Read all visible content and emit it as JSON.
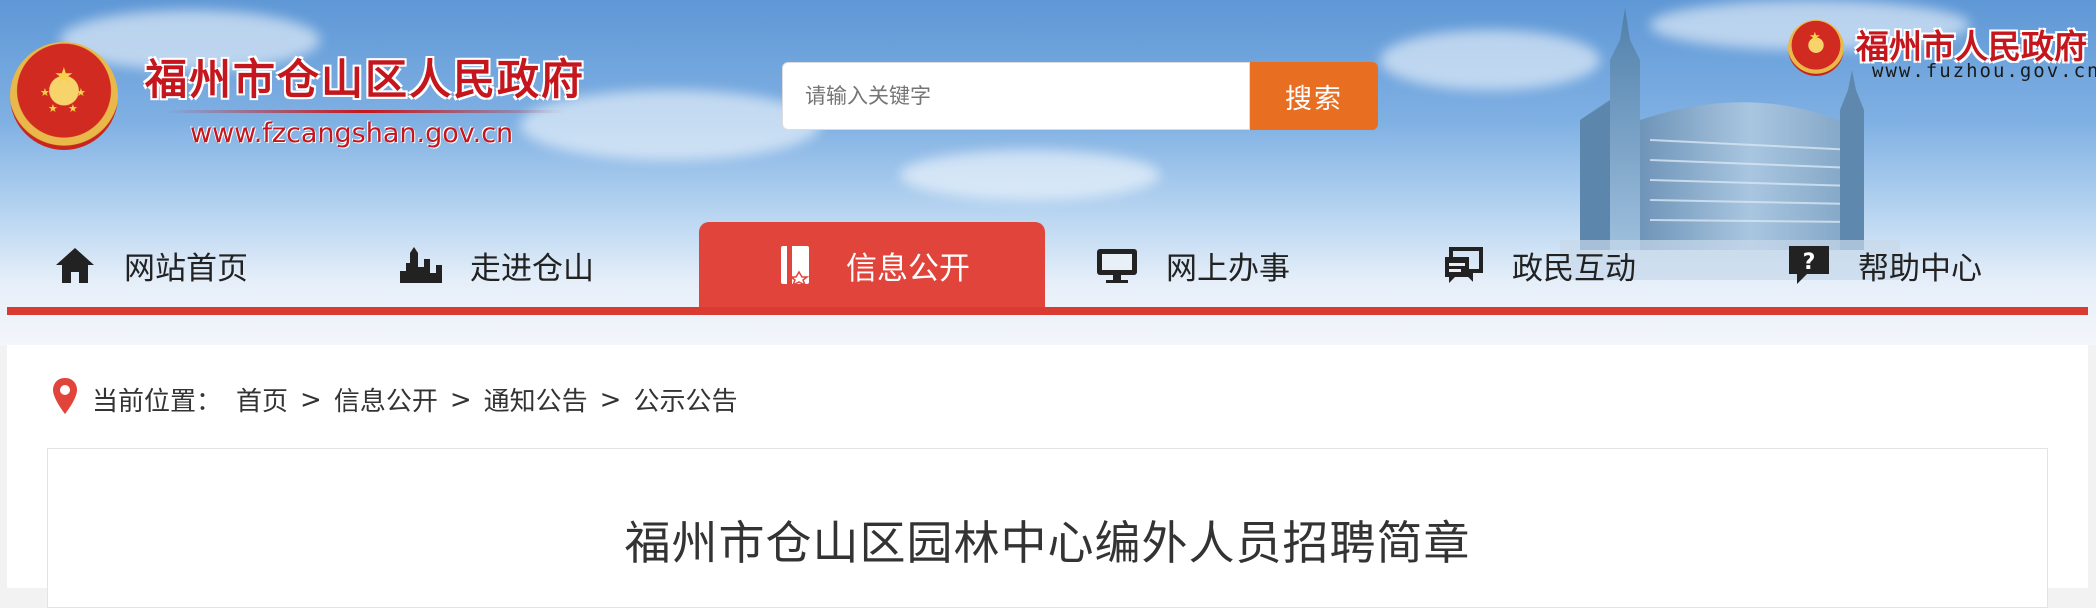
{
  "header": {
    "site_title": "福州市仓山区人民政府",
    "site_url": "www.fzcangshan.gov.cn",
    "search": {
      "placeholder": "请输入关键字",
      "button_label": "搜索"
    },
    "fuzhou_title": "福州市人民政府",
    "fuzhou_url": "www.fuzhou.gov.cn"
  },
  "nav": {
    "items": [
      {
        "label": "网站首页",
        "icon": "home-icon"
      },
      {
        "label": "走进仓山",
        "icon": "city-skyline-icon"
      },
      {
        "label": "信息公开",
        "icon": "info-book-icon",
        "active": true
      },
      {
        "label": "网上办事",
        "icon": "monitor-icon"
      },
      {
        "label": "政民互动",
        "icon": "chat-icon"
      },
      {
        "label": "帮助中心",
        "icon": "help-icon"
      }
    ]
  },
  "breadcrumb": {
    "prefix": "当前位置：",
    "items": [
      "首页",
      "信息公开",
      "通知公告",
      "公示公告"
    ],
    "separator": ">"
  },
  "article": {
    "title": "福州市仓山区园林中心编外人员招聘简章"
  },
  "colors": {
    "brand_red": "#c4161c",
    "nav_active": "#e0443b",
    "search_button": "#e86e22"
  }
}
